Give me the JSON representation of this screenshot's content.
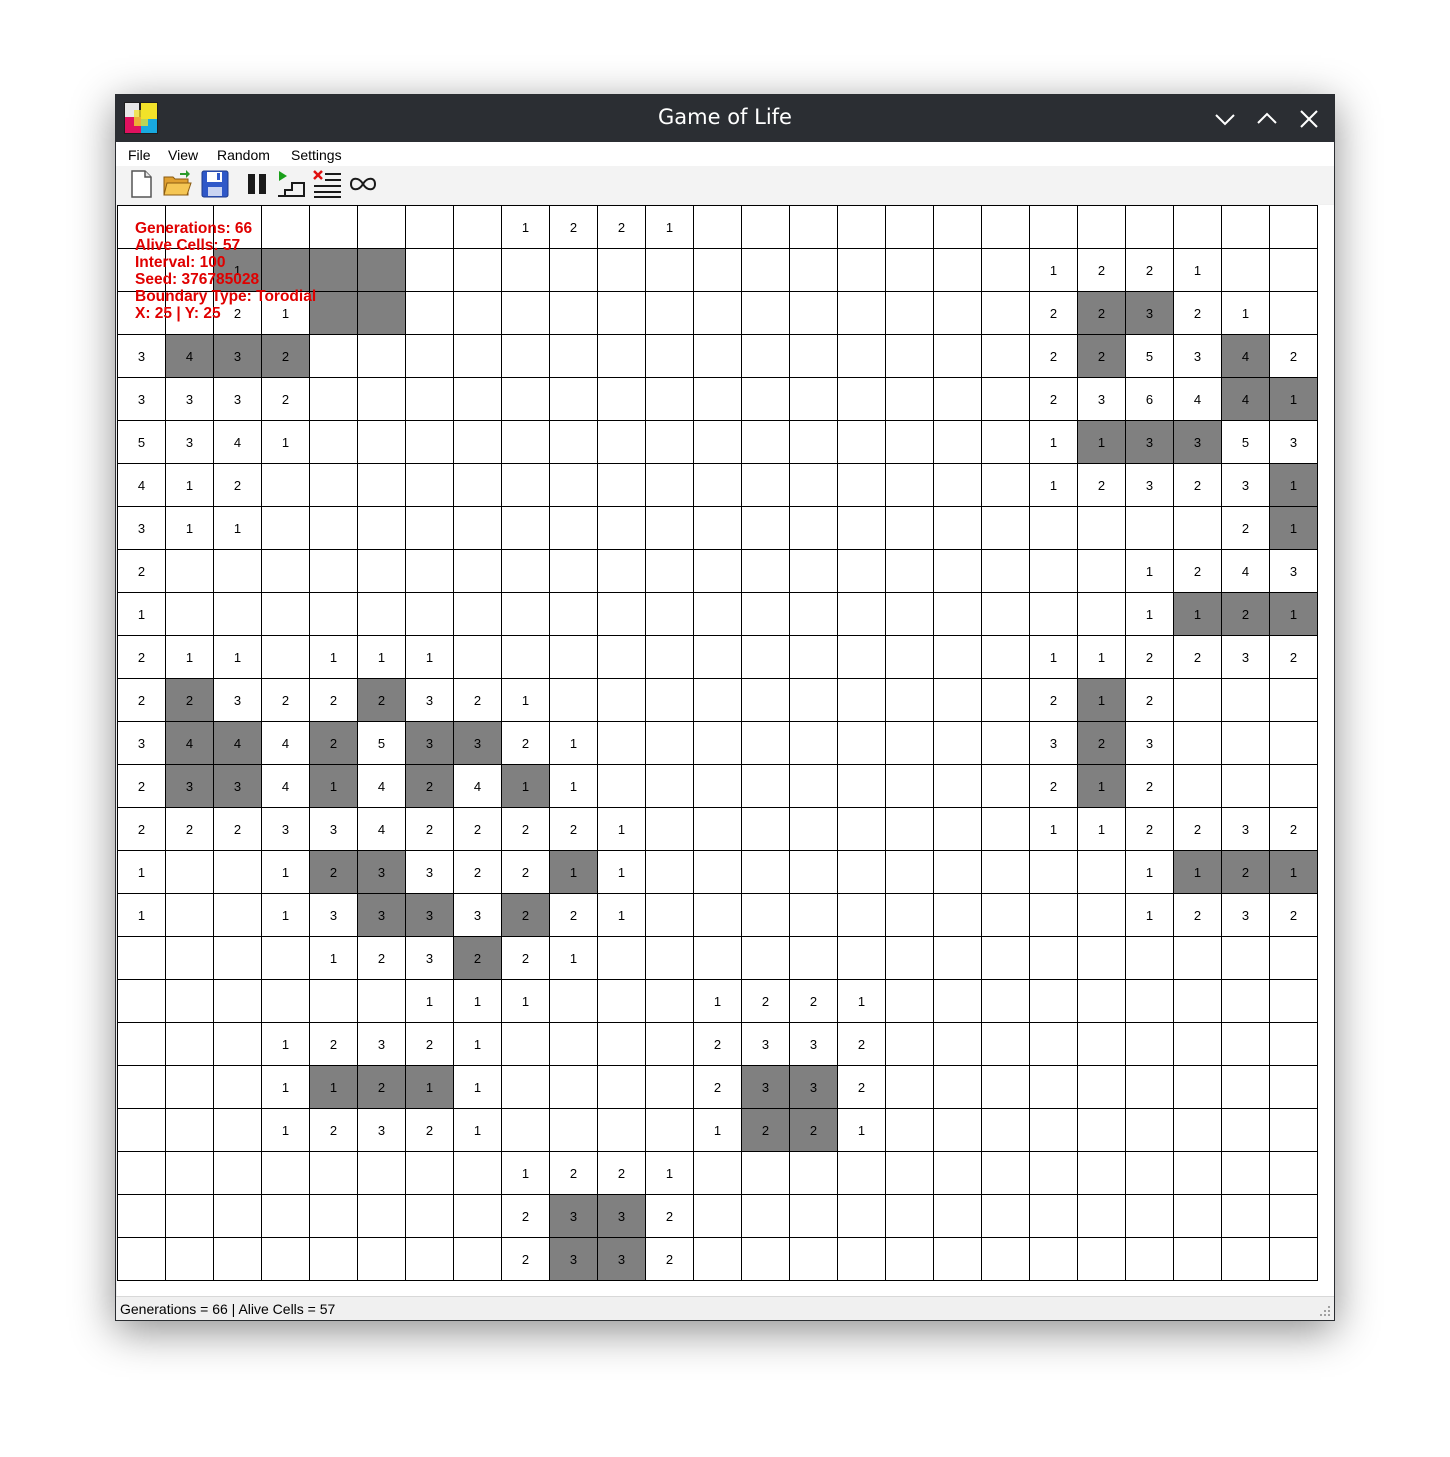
{
  "window": {
    "title": "Game of Life"
  },
  "menu": {
    "items": [
      "File",
      "View",
      "Random",
      "Settings"
    ]
  },
  "toolbar": {
    "tools": [
      "new-file-icon",
      "open-folder-icon",
      "save-icon",
      "pause-icon",
      "next-step-icon",
      "clear-grid-icon",
      "infinite-run-icon"
    ]
  },
  "hud": {
    "generations": "Generations: 66",
    "alive": "Alive Cells: 57",
    "interval": "Interval: 100",
    "seed": "Seed: 376785028",
    "boundary": "Boundary Type: Torodial",
    "coords": "X: 25 | Y: 25"
  },
  "status": {
    "text": "Generations = 66 | Alive Cells = 57"
  },
  "colors": {
    "alive": "#808080",
    "dead": "#ffffff",
    "hud": "#e00000",
    "titlebar": "#2b2e33"
  },
  "grid": {
    "cols": 25,
    "rows": 25,
    "alive": [
      [
        1,
        2
      ],
      [
        1,
        3
      ],
      [
        1,
        4
      ],
      [
        1,
        5
      ],
      [
        2,
        4
      ],
      [
        2,
        5
      ],
      [
        3,
        1
      ],
      [
        3,
        2
      ],
      [
        3,
        3
      ],
      [
        11,
        1
      ],
      [
        11,
        5
      ],
      [
        12,
        1
      ],
      [
        12,
        2
      ],
      [
        12,
        4
      ],
      [
        12,
        6
      ],
      [
        12,
        7
      ],
      [
        13,
        1
      ],
      [
        13,
        2
      ],
      [
        13,
        4
      ],
      [
        13,
        6
      ],
      [
        13,
        8
      ],
      [
        15,
        4
      ],
      [
        15,
        5
      ],
      [
        15,
        9
      ],
      [
        16,
        5
      ],
      [
        16,
        6
      ],
      [
        16,
        8
      ],
      [
        17,
        7
      ],
      [
        20,
        4
      ],
      [
        20,
        5
      ],
      [
        20,
        6
      ],
      [
        23,
        9
      ],
      [
        23,
        10
      ],
      [
        24,
        9
      ],
      [
        24,
        10
      ],
      [
        20,
        13
      ],
      [
        20,
        14
      ],
      [
        21,
        13
      ],
      [
        21,
        14
      ],
      [
        2,
        20
      ],
      [
        2,
        21
      ],
      [
        3,
        20
      ],
      [
        3,
        23
      ],
      [
        4,
        23
      ],
      [
        4,
        24
      ],
      [
        5,
        20
      ],
      [
        5,
        21
      ],
      [
        5,
        22
      ],
      [
        6,
        24
      ],
      [
        7,
        24
      ],
      [
        9,
        22
      ],
      [
        9,
        23
      ],
      [
        9,
        24
      ],
      [
        15,
        22
      ],
      [
        15,
        23
      ],
      [
        15,
        24
      ],
      [
        11,
        20
      ],
      [
        12,
        20
      ],
      [
        13,
        20
      ]
    ],
    "labels": [
      [
        "",
        "",
        "",
        "",
        "",
        "",
        "",
        "",
        "1",
        "2",
        "2",
        "1",
        "",
        "",
        "",
        "",
        "",
        "",
        "",
        "",
        "",
        "",
        "",
        "",
        ""
      ],
      [
        "",
        "",
        "1",
        "",
        "",
        "",
        "",
        "",
        "",
        "",
        "",
        "",
        "",
        "",
        "",
        "",
        "",
        "",
        "",
        "1",
        "2",
        "2",
        "1",
        "",
        ""
      ],
      [
        "",
        "",
        "2",
        "1",
        "",
        "",
        "",
        "",
        "",
        "",
        "",
        "",
        "",
        "",
        "",
        "",
        "",
        "",
        "",
        "2",
        "2",
        "3",
        "2",
        "1",
        ""
      ],
      [
        "3",
        "4",
        "3",
        "2",
        "",
        "",
        "",
        "",
        "",
        "",
        "",
        "",
        "",
        "",
        "",
        "",
        "",
        "",
        "",
        "2",
        "2",
        "5",
        "3",
        "4",
        "2"
      ],
      [
        "3",
        "3",
        "3",
        "2",
        "",
        "",
        "",
        "",
        "",
        "",
        "",
        "",
        "",
        "",
        "",
        "",
        "",
        "",
        "",
        "2",
        "3",
        "6",
        "4",
        "4",
        "1"
      ],
      [
        "5",
        "3",
        "4",
        "1",
        "",
        "",
        "",
        "",
        "",
        "",
        "",
        "",
        "",
        "",
        "",
        "",
        "",
        "",
        "",
        "1",
        "1",
        "3",
        "3",
        "5",
        "3"
      ],
      [
        "4",
        "1",
        "2",
        "",
        "",
        "",
        "",
        "",
        "",
        "",
        "",
        "",
        "",
        "",
        "",
        "",
        "",
        "",
        "",
        "1",
        "2",
        "3",
        "2",
        "3",
        "1"
      ],
      [
        "3",
        "1",
        "1",
        "",
        "",
        "",
        "",
        "",
        "",
        "",
        "",
        "",
        "",
        "",
        "",
        "",
        "",
        "",
        "",
        "",
        "",
        "",
        "",
        "2",
        "1"
      ],
      [
        "2",
        "",
        "",
        "",
        "",
        "",
        "",
        "",
        "",
        "",
        "",
        "",
        "",
        "",
        "",
        "",
        "",
        "",
        "",
        "",
        "",
        "1",
        "2",
        "4",
        "3"
      ],
      [
        "1",
        "",
        "",
        "",
        "",
        "",
        "",
        "",
        "",
        "",
        "",
        "",
        "",
        "",
        "",
        "",
        "",
        "",
        "",
        "",
        "",
        "1",
        "1",
        "2",
        "1"
      ],
      [
        "2",
        "1",
        "1",
        "",
        "1",
        "1",
        "1",
        "",
        "",
        "",
        "",
        "",
        "",
        "",
        "",
        "",
        "",
        "",
        "",
        "1",
        "1",
        "2",
        "2",
        "3",
        "2"
      ],
      [
        "2",
        "2",
        "3",
        "2",
        "2",
        "2",
        "3",
        "2",
        "1",
        "",
        "",
        "",
        "",
        "",
        "",
        "",
        "",
        "",
        "",
        "2",
        "1",
        "2",
        "",
        "",
        ""
      ],
      [
        "3",
        "4",
        "4",
        "4",
        "2",
        "5",
        "3",
        "3",
        "2",
        "1",
        "",
        "",
        "",
        "",
        "",
        "",
        "",
        "",
        "",
        "3",
        "2",
        "3",
        "",
        "",
        ""
      ],
      [
        "2",
        "3",
        "3",
        "4",
        "1",
        "4",
        "2",
        "4",
        "1",
        "1",
        "",
        "",
        "",
        "",
        "",
        "",
        "",
        "",
        "",
        "2",
        "1",
        "2",
        "",
        "",
        ""
      ],
      [
        "2",
        "2",
        "2",
        "3",
        "3",
        "4",
        "2",
        "2",
        "2",
        "2",
        "1",
        "",
        "",
        "",
        "",
        "",
        "",
        "",
        "",
        "1",
        "1",
        "2",
        "2",
        "3",
        "2"
      ],
      [
        "1",
        "",
        "",
        "1",
        "2",
        "3",
        "3",
        "2",
        "2",
        "1",
        "1",
        "",
        "",
        "",
        "",
        "",
        "",
        "",
        "",
        "",
        "",
        "1",
        "1",
        "2",
        "1"
      ],
      [
        "1",
        "",
        "",
        "1",
        "3",
        "3",
        "3",
        "3",
        "2",
        "2",
        "1",
        "",
        "",
        "",
        "",
        "",
        "",
        "",
        "",
        "",
        "",
        "1",
        "2",
        "3",
        "2"
      ],
      [
        "",
        "",
        "",
        "",
        "1",
        "2",
        "3",
        "2",
        "2",
        "1",
        "",
        "",
        "",
        "",
        "",
        "",
        "",
        "",
        "",
        "",
        "",
        "",
        "",
        "",
        ""
      ],
      [
        "",
        "",
        "",
        "",
        "",
        "",
        "1",
        "1",
        "1",
        "",
        "",
        "",
        "1",
        "2",
        "2",
        "1",
        "",
        "",
        "",
        "",
        "",
        "",
        "",
        "",
        ""
      ],
      [
        "",
        "",
        "",
        "1",
        "2",
        "3",
        "2",
        "1",
        "",
        "",
        "",
        "",
        "2",
        "3",
        "3",
        "2",
        "",
        "",
        "",
        "",
        "",
        "",
        "",
        "",
        ""
      ],
      [
        "",
        "",
        "",
        "1",
        "1",
        "2",
        "1",
        "1",
        "",
        "",
        "",
        "",
        "2",
        "3",
        "3",
        "2",
        "",
        "",
        "",
        "",
        "",
        "",
        "",
        "",
        ""
      ],
      [
        "",
        "",
        "",
        "1",
        "2",
        "3",
        "2",
        "1",
        "",
        "",
        "",
        "",
        "1",
        "2",
        "2",
        "1",
        "",
        "",
        "",
        "",
        "",
        "",
        "",
        "",
        ""
      ],
      [
        "",
        "",
        "",
        "",
        "",
        "",
        "",
        "",
        "1",
        "2",
        "2",
        "1",
        "",
        "",
        "",
        "",
        "",
        "",
        "",
        "",
        "",
        "",
        "",
        "",
        ""
      ],
      [
        "",
        "",
        "",
        "",
        "",
        "",
        "",
        "",
        "2",
        "3",
        "3",
        "2",
        "",
        "",
        "",
        "",
        "",
        "",
        "",
        "",
        "",
        "",
        "",
        "",
        ""
      ],
      [
        "",
        "",
        "",
        "",
        "",
        "",
        "",
        "",
        "2",
        "3",
        "3",
        "2",
        "",
        "",
        "",
        "",
        "",
        "",
        "",
        "",
        "",
        "",
        "",
        "",
        ""
      ]
    ]
  }
}
